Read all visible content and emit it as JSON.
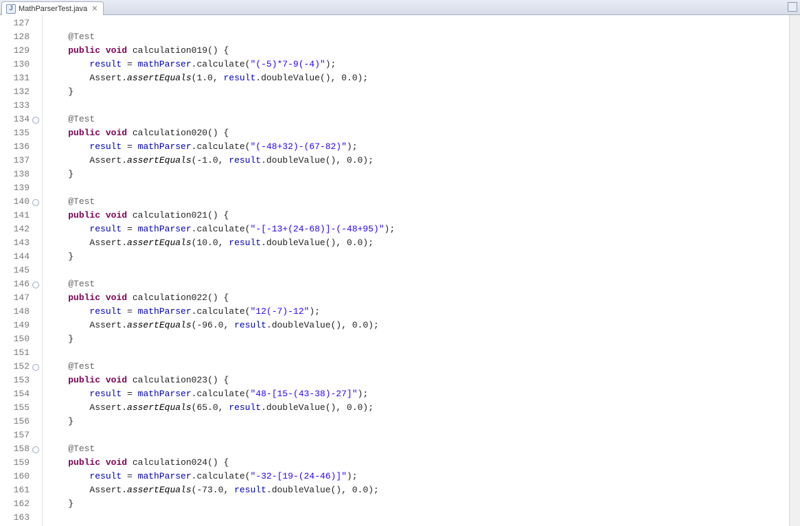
{
  "tab": {
    "filename": "MathParserTest.java",
    "fileIconLetter": "J",
    "closeGlyph": "✕"
  },
  "lines": [
    {
      "n": 127,
      "fold": false,
      "tokens": []
    },
    {
      "n": 128,
      "fold": false,
      "tokens": [
        [
          "    ",
          "plain"
        ],
        [
          "@Test",
          "anno"
        ]
      ]
    },
    {
      "n": 129,
      "fold": false,
      "tokens": [
        [
          "    ",
          "plain"
        ],
        [
          "public",
          "kw"
        ],
        [
          " ",
          "plain"
        ],
        [
          "void",
          "kw"
        ],
        [
          " calculation019() {",
          "plain"
        ]
      ]
    },
    {
      "n": 130,
      "fold": false,
      "tokens": [
        [
          "        ",
          "plain"
        ],
        [
          "result",
          "fld"
        ],
        [
          " = ",
          "plain"
        ],
        [
          "mathParser",
          "fld"
        ],
        [
          ".calculate(",
          "plain"
        ],
        [
          "\"(-5)*7-9(-4)\"",
          "str"
        ],
        [
          ");",
          "plain"
        ]
      ]
    },
    {
      "n": 131,
      "fold": false,
      "tokens": [
        [
          "        Assert.",
          "plain"
        ],
        [
          "assertEquals",
          "mi"
        ],
        [
          "(1.0, ",
          "plain"
        ],
        [
          "result",
          "fld"
        ],
        [
          ".doubleValue(), 0.0);",
          "plain"
        ]
      ]
    },
    {
      "n": 132,
      "fold": false,
      "tokens": [
        [
          "    }",
          "plain"
        ]
      ]
    },
    {
      "n": 133,
      "fold": false,
      "tokens": []
    },
    {
      "n": 134,
      "fold": true,
      "tokens": [
        [
          "    ",
          "plain"
        ],
        [
          "@Test",
          "anno"
        ]
      ]
    },
    {
      "n": 135,
      "fold": false,
      "tokens": [
        [
          "    ",
          "plain"
        ],
        [
          "public",
          "kw"
        ],
        [
          " ",
          "plain"
        ],
        [
          "void",
          "kw"
        ],
        [
          " calculation020() {",
          "plain"
        ]
      ]
    },
    {
      "n": 136,
      "fold": false,
      "tokens": [
        [
          "        ",
          "plain"
        ],
        [
          "result",
          "fld"
        ],
        [
          " = ",
          "plain"
        ],
        [
          "mathParser",
          "fld"
        ],
        [
          ".calculate(",
          "plain"
        ],
        [
          "\"(-48+32)-(67-82)\"",
          "str"
        ],
        [
          ");",
          "plain"
        ]
      ]
    },
    {
      "n": 137,
      "fold": false,
      "tokens": [
        [
          "        Assert.",
          "plain"
        ],
        [
          "assertEquals",
          "mi"
        ],
        [
          "(-1.0, ",
          "plain"
        ],
        [
          "result",
          "fld"
        ],
        [
          ".doubleValue(), 0.0);",
          "plain"
        ]
      ]
    },
    {
      "n": 138,
      "fold": false,
      "tokens": [
        [
          "    }",
          "plain"
        ]
      ]
    },
    {
      "n": 139,
      "fold": false,
      "tokens": []
    },
    {
      "n": 140,
      "fold": true,
      "tokens": [
        [
          "    ",
          "plain"
        ],
        [
          "@Test",
          "anno"
        ]
      ]
    },
    {
      "n": 141,
      "fold": false,
      "tokens": [
        [
          "    ",
          "plain"
        ],
        [
          "public",
          "kw"
        ],
        [
          " ",
          "plain"
        ],
        [
          "void",
          "kw"
        ],
        [
          " calculation021() {",
          "plain"
        ]
      ]
    },
    {
      "n": 142,
      "fold": false,
      "tokens": [
        [
          "        ",
          "plain"
        ],
        [
          "result",
          "fld"
        ],
        [
          " = ",
          "plain"
        ],
        [
          "mathParser",
          "fld"
        ],
        [
          ".calculate(",
          "plain"
        ],
        [
          "\"-[-13+(24-68)]-(-48+95)\"",
          "str"
        ],
        [
          ");",
          "plain"
        ]
      ]
    },
    {
      "n": 143,
      "fold": false,
      "tokens": [
        [
          "        Assert.",
          "plain"
        ],
        [
          "assertEquals",
          "mi"
        ],
        [
          "(10.0, ",
          "plain"
        ],
        [
          "result",
          "fld"
        ],
        [
          ".doubleValue(), 0.0);",
          "plain"
        ]
      ]
    },
    {
      "n": 144,
      "fold": false,
      "tokens": [
        [
          "    }",
          "plain"
        ]
      ]
    },
    {
      "n": 145,
      "fold": false,
      "tokens": []
    },
    {
      "n": 146,
      "fold": true,
      "tokens": [
        [
          "    ",
          "plain"
        ],
        [
          "@Test",
          "anno"
        ]
      ]
    },
    {
      "n": 147,
      "fold": false,
      "tokens": [
        [
          "    ",
          "plain"
        ],
        [
          "public",
          "kw"
        ],
        [
          " ",
          "plain"
        ],
        [
          "void",
          "kw"
        ],
        [
          " calculation022() {",
          "plain"
        ]
      ]
    },
    {
      "n": 148,
      "fold": false,
      "tokens": [
        [
          "        ",
          "plain"
        ],
        [
          "result",
          "fld"
        ],
        [
          " = ",
          "plain"
        ],
        [
          "mathParser",
          "fld"
        ],
        [
          ".calculate(",
          "plain"
        ],
        [
          "\"12(-7)-12\"",
          "str"
        ],
        [
          ");",
          "plain"
        ]
      ]
    },
    {
      "n": 149,
      "fold": false,
      "tokens": [
        [
          "        Assert.",
          "plain"
        ],
        [
          "assertEquals",
          "mi"
        ],
        [
          "(-96.0, ",
          "plain"
        ],
        [
          "result",
          "fld"
        ],
        [
          ".doubleValue(), 0.0);",
          "plain"
        ]
      ]
    },
    {
      "n": 150,
      "fold": false,
      "tokens": [
        [
          "    }",
          "plain"
        ]
      ]
    },
    {
      "n": 151,
      "fold": false,
      "tokens": []
    },
    {
      "n": 152,
      "fold": true,
      "tokens": [
        [
          "    ",
          "plain"
        ],
        [
          "@Test",
          "anno"
        ]
      ]
    },
    {
      "n": 153,
      "fold": false,
      "tokens": [
        [
          "    ",
          "plain"
        ],
        [
          "public",
          "kw"
        ],
        [
          " ",
          "plain"
        ],
        [
          "void",
          "kw"
        ],
        [
          " calculation023() {",
          "plain"
        ]
      ]
    },
    {
      "n": 154,
      "fold": false,
      "tokens": [
        [
          "        ",
          "plain"
        ],
        [
          "result",
          "fld"
        ],
        [
          " = ",
          "plain"
        ],
        [
          "mathParser",
          "fld"
        ],
        [
          ".calculate(",
          "plain"
        ],
        [
          "\"48-[15-(43-38)-27]\"",
          "str"
        ],
        [
          ");",
          "plain"
        ]
      ]
    },
    {
      "n": 155,
      "fold": false,
      "tokens": [
        [
          "        Assert.",
          "plain"
        ],
        [
          "assertEquals",
          "mi"
        ],
        [
          "(65.0, ",
          "plain"
        ],
        [
          "result",
          "fld"
        ],
        [
          ".doubleValue(), 0.0);",
          "plain"
        ]
      ]
    },
    {
      "n": 156,
      "fold": false,
      "tokens": [
        [
          "    }",
          "plain"
        ]
      ]
    },
    {
      "n": 157,
      "fold": false,
      "tokens": []
    },
    {
      "n": 158,
      "fold": true,
      "tokens": [
        [
          "    ",
          "plain"
        ],
        [
          "@Test",
          "anno"
        ]
      ]
    },
    {
      "n": 159,
      "fold": false,
      "tokens": [
        [
          "    ",
          "plain"
        ],
        [
          "public",
          "kw"
        ],
        [
          " ",
          "plain"
        ],
        [
          "void",
          "kw"
        ],
        [
          " calculation024() {",
          "plain"
        ]
      ]
    },
    {
      "n": 160,
      "fold": false,
      "tokens": [
        [
          "        ",
          "plain"
        ],
        [
          "result",
          "fld"
        ],
        [
          " = ",
          "plain"
        ],
        [
          "mathParser",
          "fld"
        ],
        [
          ".calculate(",
          "plain"
        ],
        [
          "\"-32-[19-(24-46)]\"",
          "str"
        ],
        [
          ");",
          "plain"
        ]
      ]
    },
    {
      "n": 161,
      "fold": false,
      "tokens": [
        [
          "        Assert.",
          "plain"
        ],
        [
          "assertEquals",
          "mi"
        ],
        [
          "(-73.0, ",
          "plain"
        ],
        [
          "result",
          "fld"
        ],
        [
          ".doubleValue(), 0.0);",
          "plain"
        ]
      ]
    },
    {
      "n": 162,
      "fold": false,
      "tokens": [
        [
          "    }",
          "plain"
        ]
      ]
    },
    {
      "n": 163,
      "fold": false,
      "tokens": []
    }
  ]
}
